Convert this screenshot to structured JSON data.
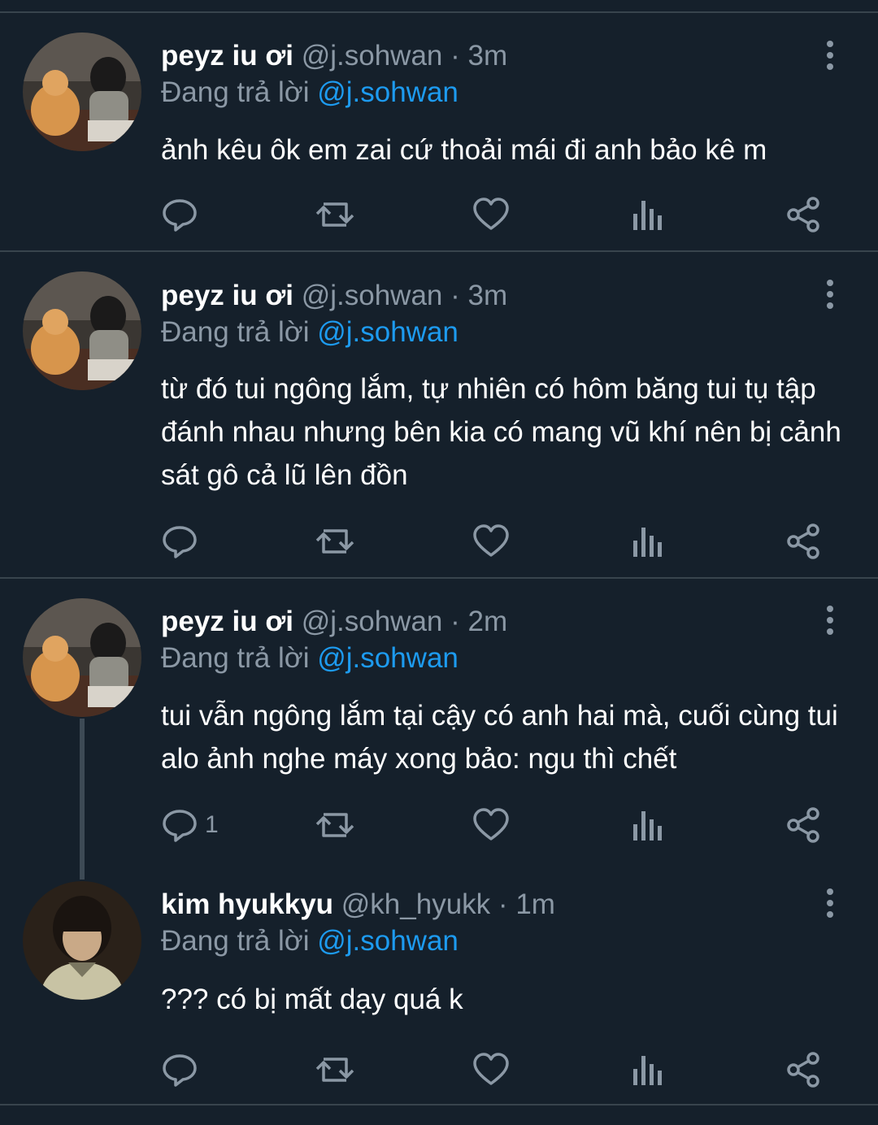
{
  "reply_prefix": "Đang trả lời",
  "tweets": [
    {
      "name": "peyz iu ơi",
      "handle": "@j.sohwan",
      "separator": "·",
      "time": "3m",
      "reply_to": "@j.sohwan",
      "text": "ảnh kêu ôk em zai cứ thoải mái đi anh bảo kê m",
      "reply_count": ""
    },
    {
      "name": "peyz iu ơi",
      "handle": "@j.sohwan",
      "separator": "·",
      "time": "3m",
      "reply_to": "@j.sohwan",
      "text": "từ đó tui ngông lắm, tự nhiên có hôm băng tui tụ tập đánh nhau nhưng bên kia có mang vũ khí nên bị cảnh sát gô cả lũ lên đồn",
      "reply_count": ""
    },
    {
      "name": "peyz iu ơi",
      "handle": "@j.sohwan",
      "separator": "·",
      "time": "2m",
      "reply_to": "@j.sohwan",
      "text": "tui vẫn ngông lắm tại cậy có anh hai mà, cuối cùng tui alo ảnh nghe máy xong bảo: ngu thì chết",
      "reply_count": "1"
    },
    {
      "name": "kim hyukkyu",
      "handle": "@kh_hyukk",
      "separator": "·",
      "time": "1m",
      "reply_to": "@j.sohwan",
      "text": "??? có bị mất dạy quá k",
      "reply_count": ""
    }
  ],
  "icons": [
    "reply-icon",
    "retweet-icon",
    "like-icon",
    "analytics-icon",
    "share-icon",
    "more-options-icon"
  ],
  "colors": {
    "background": "#15202b",
    "divider": "#38444d",
    "secondary_text": "#8b98a5",
    "mention": "#1d9bf0"
  }
}
